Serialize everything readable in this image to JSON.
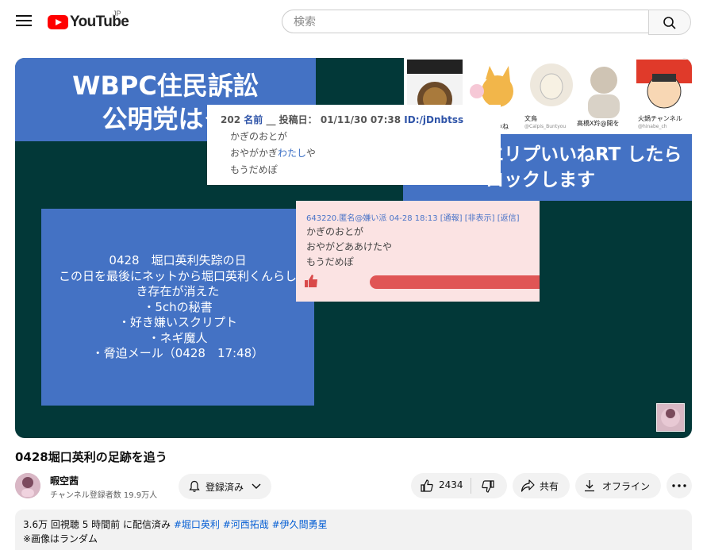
{
  "header": {
    "logo_text": "YouTube",
    "country_code": "JP",
    "search_placeholder": "検索"
  },
  "video": {
    "slide_title_line1": "WBPC住民訴訟",
    "slide_title_line2": "公明党はク",
    "right_banner_line1": "エリプいいねRT したら",
    "right_banner_line2": "ロックします",
    "icon_tiles": [
      {
        "caption": "",
        "subcaption": ""
      },
      {
        "caption": "ぎつね",
        "subcaption": ""
      },
      {
        "caption": "文鳥",
        "subcaption": "@Calpis_Buntyou"
      },
      {
        "caption": "髙橋X羚@開を",
        "subcaption": ""
      },
      {
        "caption": "火鍋チャンネル",
        "subcaption": "@hinabe_ch"
      }
    ],
    "post1": {
      "number": "202",
      "name_label": "名前",
      "name_value": "__",
      "date_label": "投稿日：",
      "date_value": "01/11/30 07:38",
      "id_label": "ID:/jDnbtss",
      "lines": [
        "かぎのおとが",
        "おやがかぎ",
        "わたし",
        "や",
        "もうだめぽ"
      ]
    },
    "post2": {
      "header": "643220.匿名@嫌い派 04-28 18:13 [通報] [非表示] [返信]",
      "lines": [
        "かぎのおとが",
        "おやがどああけたや",
        "もうだめぽ"
      ]
    },
    "left_box_lines": [
      "0428　堀口英利失踪の日",
      "この日を最後にネットから堀口英利くんらし",
      "き存在が消えた",
      "・5chの秘書",
      "・好き嫌いスクリプト",
      "・ネギ魔人",
      "・脅迫メール（0428　17:48）"
    ]
  },
  "meta": {
    "title": "0428堀口英利の足跡を追う",
    "channel_name": "暇空茜",
    "subscribers": "チャンネル登録者数 19.9万人",
    "subscribe_label": "登録済み",
    "like_count": "2434",
    "share_label": "共有",
    "offline_label": "オフライン",
    "more_label": "…"
  },
  "description": {
    "stats": "3.6万 回視聴  5 時間前 に配信済み",
    "hashtags": [
      "#堀口英利",
      "#河西拓哉",
      "#伊久間勇星"
    ],
    "note": "※画像はランダム"
  },
  "colors": {
    "slide_blue": "#4472c4",
    "slide_bg": "#023838",
    "youtube_red": "#ff0000",
    "link_blue": "#065fd4"
  }
}
